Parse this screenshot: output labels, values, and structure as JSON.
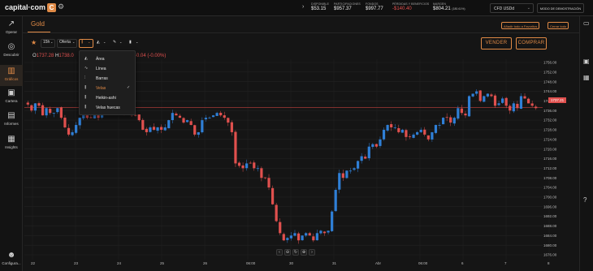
{
  "app": {
    "logo_text": "capital·com",
    "logo_badge": "C"
  },
  "topbar": {
    "stats": [
      {
        "label": "DISPONIBLE",
        "value": "$53.15",
        "negative": false
      },
      {
        "label": "PARTICIPACIONES",
        "value": "$957.37",
        "negative": false
      },
      {
        "label": "FONDOS",
        "value": "$997.77",
        "negative": false
      },
      {
        "label": "PÉRDIDAS Y BENEFICIOS",
        "value": "-$140.40",
        "negative": true
      },
      {
        "label": "MARGEN",
        "value": "$804.21",
        "pct": "(180.61%)",
        "negative": false
      }
    ],
    "account_select": "CFD USDd",
    "demo_button": "MODO DE DEMOSTRACIÓN"
  },
  "sidebar": {
    "items": [
      {
        "label": "Operar",
        "icon": "trade-icon",
        "glyph": "↗",
        "active": false
      },
      {
        "label": "Descubrir",
        "icon": "compass-icon",
        "glyph": "◎",
        "active": false
      },
      {
        "label": "Gráficos",
        "icon": "charts-icon",
        "glyph": "▥",
        "active": true
      },
      {
        "label": "Cartera",
        "icon": "wallet-icon",
        "glyph": "▣",
        "active": false
      },
      {
        "label": "Informes",
        "icon": "reports-icon",
        "glyph": "▤",
        "active": false
      },
      {
        "label": "Insights",
        "icon": "insights-icon",
        "glyph": "▦",
        "active": false
      },
      {
        "label": "Configura...",
        "icon": "settings-icon",
        "glyph": "☻",
        "active": false
      }
    ]
  },
  "instrument": {
    "title": "Gold",
    "add_favorites": "Añadir todo a Favoritos",
    "close_all": "Cerrar todo"
  },
  "toolbar": {
    "timeframe": "15h",
    "price_type": "Oferta",
    "sell_label": "VENDER",
    "buy_label": "COMPRAR"
  },
  "ohlc": {
    "o_key": "O",
    "o": "1737.28",
    "h_key": "H",
    "h": "1738.0",
    "change": "-0.04 (-0.00%)"
  },
  "chart_type_menu": {
    "items": [
      {
        "label": "Área",
        "icon": "area-chart-icon",
        "glyph": "◭",
        "selected": false
      },
      {
        "label": "Línea",
        "icon": "line-chart-icon",
        "glyph": "∿",
        "selected": false
      },
      {
        "label": "Barras",
        "icon": "bars-chart-icon",
        "glyph": "⫶",
        "selected": false
      },
      {
        "label": "Velas",
        "icon": "candles-chart-icon",
        "glyph": "⫼",
        "selected": true
      },
      {
        "label": "Heikin-ashi",
        "icon": "heikin-ashi-icon",
        "glyph": "⫼",
        "selected": false
      },
      {
        "label": "Velas huecas",
        "icon": "hollow-candles-icon",
        "glyph": "⫼",
        "selected": false
      }
    ],
    "check_glyph": "✓"
  },
  "chart_data": {
    "type": "candlestick",
    "y_ticks": [
      "1756.00",
      "1752.00",
      "1748.00",
      "1744.00",
      "1740.00",
      "1736.00",
      "1732.00",
      "1728.00",
      "1724.00",
      "1720.00",
      "1716.00",
      "1712.00",
      "1708.00",
      "1704.00",
      "1700.00",
      "1696.00",
      "1692.00",
      "1688.00",
      "1684.00",
      "1680.00",
      "1676.00"
    ],
    "ylim": [
      1676,
      1756
    ],
    "current_price_label": "1737.21",
    "current_price": 1737.21,
    "x_ticks": [
      "22",
      "23",
      "24",
      "25",
      "26",
      "06:00",
      "30",
      "31",
      "Abr",
      "06:00",
      "6",
      "7",
      "8"
    ],
    "close_path": [
      1738.5,
      1736,
      1739,
      1738,
      1734,
      1737,
      1735,
      1735,
      1737,
      1733,
      1729,
      1726,
      1727,
      1730,
      1733,
      1735,
      1733,
      1733,
      1736,
      1733,
      1736,
      1735,
      1739,
      1740,
      1738,
      1737,
      1735,
      1735,
      1734,
      1734,
      1732,
      1728,
      1727,
      1729,
      1728,
      1729,
      1728,
      1729,
      1732,
      1735,
      1734,
      1733,
      1731,
      1732,
      1730,
      1726,
      1727,
      1732,
      1733,
      1733,
      1734,
      1735,
      1734,
      1733,
      1731,
      1727,
      1714,
      1713,
      1712,
      1714,
      1714,
      1712,
      1712,
      1708,
      1708,
      1704,
      1697,
      1690,
      1685,
      1682,
      1683,
      1684,
      1685,
      1682,
      1684,
      1685,
      1684,
      1682,
      1685,
      1686,
      1685,
      1686,
      1694,
      1703,
      1710,
      1708,
      1711,
      1711,
      1712,
      1715,
      1717,
      1716,
      1721,
      1722,
      1721,
      1724,
      1728,
      1730,
      1729,
      1729,
      1727,
      1728,
      1725,
      1725,
      1726,
      1727,
      1728,
      1726,
      1724,
      1727,
      1730,
      1730,
      1733,
      1733,
      1731,
      1733,
      1737,
      1735,
      1734,
      1742,
      1743,
      1744,
      1740,
      1742,
      1743,
      1742,
      1738,
      1739,
      1741,
      1738,
      1736,
      1739,
      1737,
      1742,
      1741,
      1739,
      1738,
      1737
    ]
  },
  "bottom_nav": [
    "‹",
    "⊖",
    "↻",
    "⊕",
    "›"
  ]
}
